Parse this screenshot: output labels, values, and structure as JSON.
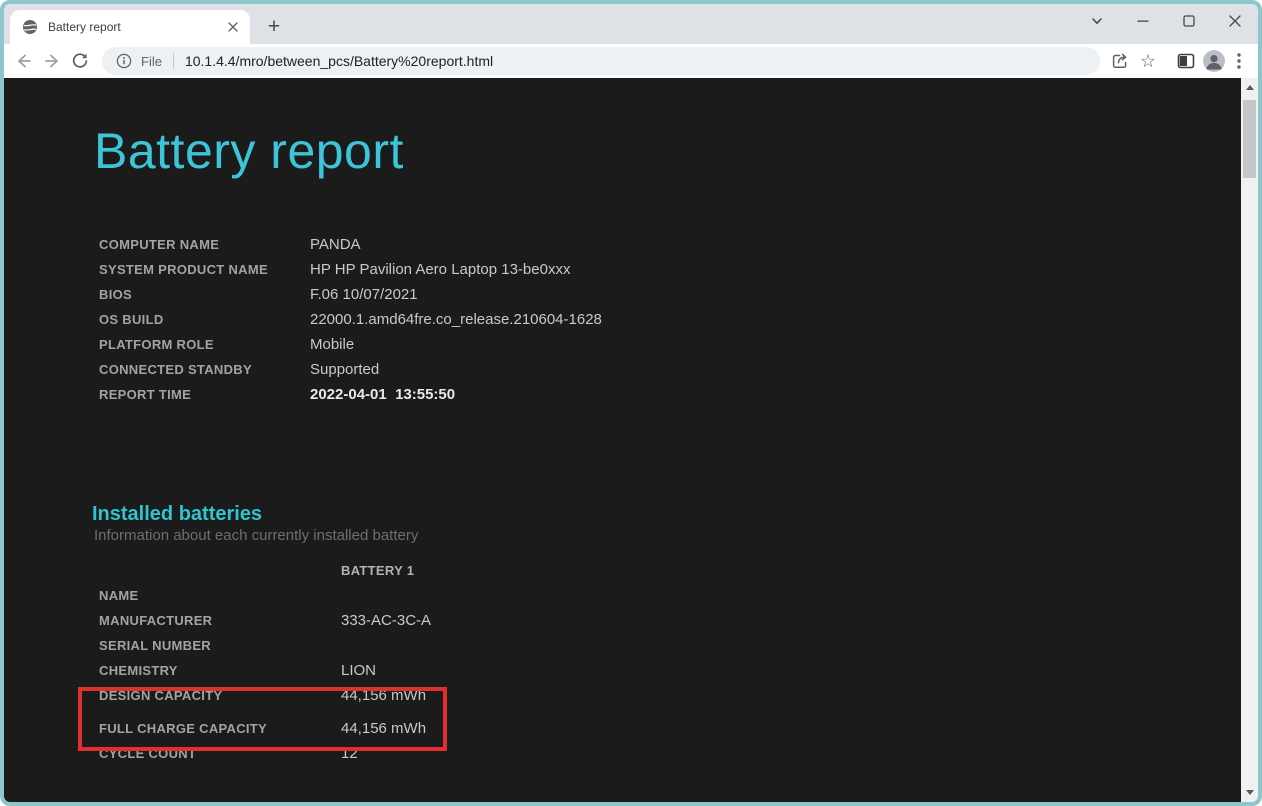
{
  "tab": {
    "title": "Battery report"
  },
  "toolbar": {
    "scheme_label": "File",
    "url": "10.1.4.4/mro/between_pcs/Battery%20report.html"
  },
  "icons": {
    "star": "☆",
    "new_tab": "+"
  },
  "colors": {
    "accent_cyan": "#3cc5d9",
    "section_cyan": "#2fc5ce",
    "annotation_red": "#e12f2f",
    "page_background": "#1b1b1b",
    "frame_teal": "#8ec6cc"
  },
  "report": {
    "title": "Battery report",
    "system_info": [
      {
        "label": "COMPUTER NAME",
        "value": "PANDA"
      },
      {
        "label": "SYSTEM PRODUCT NAME",
        "value": "HP HP Pavilion Aero Laptop 13-be0xxx"
      },
      {
        "label": "BIOS",
        "value": "F.06 10/07/2021"
      },
      {
        "label": "OS BUILD",
        "value": "22000.1.amd64fre.co_release.210604-1628"
      },
      {
        "label": "PLATFORM ROLE",
        "value": "Mobile"
      },
      {
        "label": "CONNECTED STANDBY",
        "value": "Supported"
      },
      {
        "label": "REPORT TIME",
        "value": "2022-04-01  13:55:50"
      }
    ],
    "installed_batteries": {
      "heading": "Installed batteries",
      "subtitle": "Information about each currently installed battery",
      "column_header": "BATTERY 1",
      "rows": [
        {
          "label": "NAME",
          "value": ""
        },
        {
          "label": "MANUFACTURER",
          "value": "333-AC-3C-A"
        },
        {
          "label": "SERIAL NUMBER",
          "value": ""
        },
        {
          "label": "CHEMISTRY",
          "value": "LION"
        },
        {
          "label": "DESIGN CAPACITY",
          "value": "44,156 mWh"
        },
        {
          "label": "FULL CHARGE CAPACITY",
          "value": "44,156 mWh"
        },
        {
          "label": "CYCLE COUNT",
          "value": "12"
        }
      ]
    }
  }
}
